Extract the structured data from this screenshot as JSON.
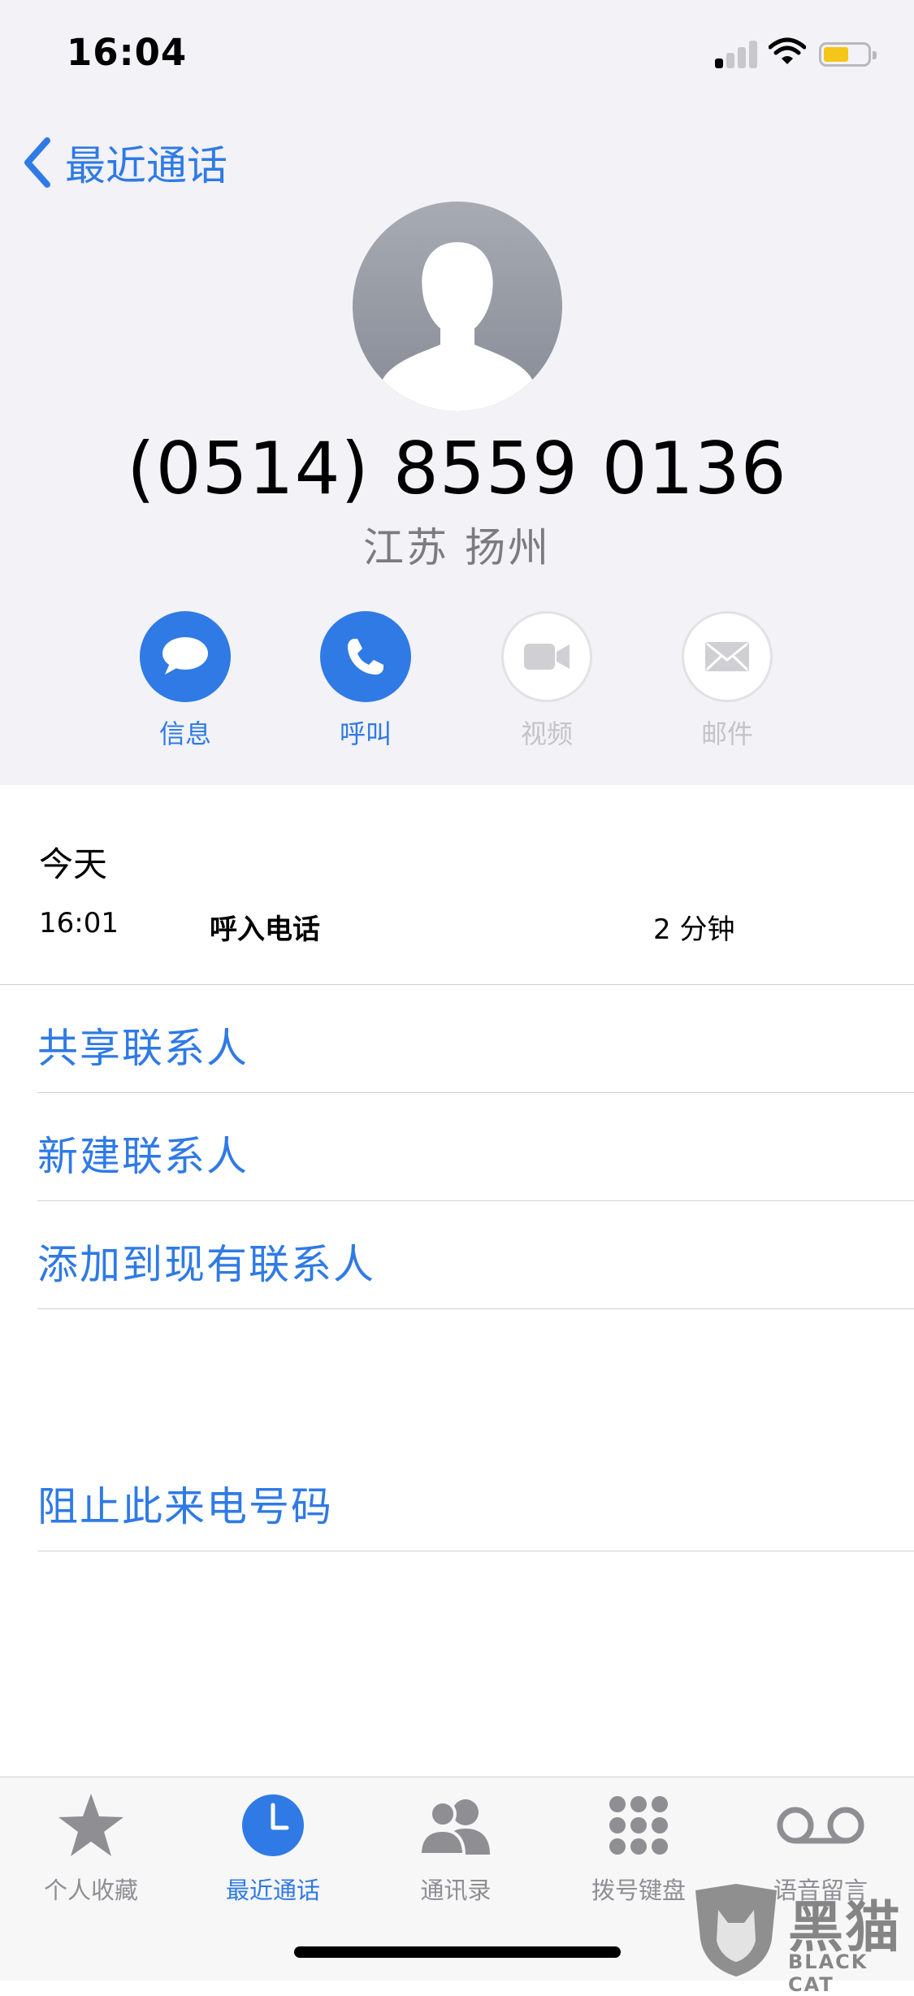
{
  "status_bar": {
    "time": "16:04",
    "icons": [
      "signal-icon",
      "wifi-icon",
      "battery-icon"
    ],
    "battery_color": "#f5c518"
  },
  "nav": {
    "back_label": "最近通话"
  },
  "contact": {
    "phone_number": "(0514) 8559 0136",
    "location": "江苏 扬州"
  },
  "actions": [
    {
      "label": "信息",
      "icon": "message-icon",
      "enabled": true
    },
    {
      "label": "呼叫",
      "icon": "phone-icon",
      "enabled": true
    },
    {
      "label": "视频",
      "icon": "video-icon",
      "enabled": false
    },
    {
      "label": "邮件",
      "icon": "mail-icon",
      "enabled": false
    }
  ],
  "call_log": {
    "section": "今天",
    "entries": [
      {
        "time": "16:01",
        "type": "呼入电话",
        "duration": "2 分钟"
      }
    ]
  },
  "options": {
    "share_contact": "共享联系人",
    "new_contact": "新建联系人",
    "add_to_existing": "添加到现有联系人",
    "block_caller": "阻止此来电号码"
  },
  "tab_bar": {
    "active": "最近通话",
    "tabs": [
      {
        "label": "个人收藏",
        "icon": "star-icon"
      },
      {
        "label": "最近通话",
        "icon": "clock-icon"
      },
      {
        "label": "通讯录",
        "icon": "contacts-icon"
      },
      {
        "label": "拨号键盘",
        "icon": "keypad-icon"
      },
      {
        "label": "语音留言",
        "icon": "voicemail-icon"
      }
    ]
  },
  "watermark": {
    "chinese": "黑猫",
    "english": "BLACK CAT"
  },
  "colors": {
    "accent": "#2f7ae5",
    "header_bg": "#f2f2f7",
    "muted": "#8e8e93"
  }
}
